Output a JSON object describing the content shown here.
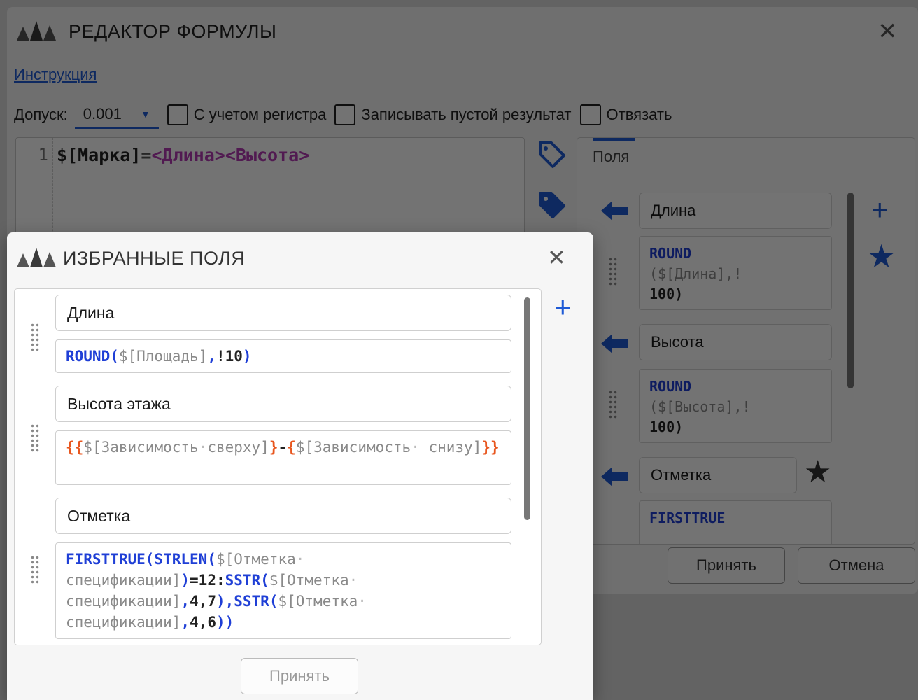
{
  "main_dialog": {
    "title": "РЕДАКТОР ФОРМУЛЫ",
    "instruction_link": "Инструкция",
    "tolerance_label": "Допуск:",
    "tolerance_value": "0.001",
    "checkboxes": [
      "С учетом регистра",
      "Записывать пустой результат",
      "Отвязать"
    ],
    "editor": {
      "line_number": "1",
      "code_var": "$[Марка]",
      "code_op": "=",
      "code_placeholders": "<Длина><Высота>"
    },
    "fields_tab": "Поля",
    "fields": [
      {
        "name": "Длина",
        "expr_fn": "ROUND",
        "expr_arg": "($[Длина],!",
        "expr_tail": "100)"
      },
      {
        "name": "Высота",
        "expr_fn": "ROUND",
        "expr_arg": "($[Высота],!",
        "expr_tail": "100)"
      },
      {
        "name": "Отметка",
        "expr_fn": "FIRSTTRUE"
      }
    ],
    "accept_button": "Принять",
    "cancel_button": "Отмена"
  },
  "favorites_dialog": {
    "title": "ИЗБРАННЫЕ ПОЛЯ",
    "items": [
      {
        "name": "Длина"
      },
      {
        "name": "Высота этажа"
      },
      {
        "name": "Отметка"
      }
    ],
    "accept_button": "Принять"
  },
  "colors": {
    "accent": "#1f5bd6",
    "function": "#1f3fd6",
    "argument": "#8a8a8a",
    "brace": "#e8561e",
    "placeholder": "#b43ab4"
  }
}
